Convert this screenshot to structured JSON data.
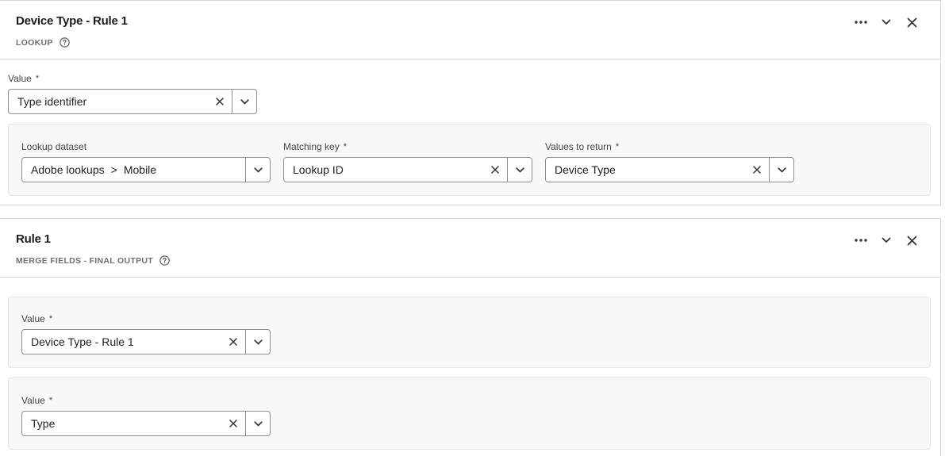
{
  "card1": {
    "title": "Device Type - Rule 1",
    "subtitle": "LOOKUP",
    "value_label": "Value",
    "value_text": "Type identifier",
    "lookup_dataset_label": "Lookup dataset",
    "lookup_dataset_parts": [
      "Adobe lookups",
      ">",
      "Mobile"
    ],
    "matching_key_label": "Matching key",
    "matching_key_value": "Lookup ID",
    "values_return_label": "Values to return",
    "values_return_value": "Device Type"
  },
  "card2": {
    "title": "Rule 1",
    "subtitle": "MERGE FIELDS - FINAL OUTPUT",
    "value1_label": "Value",
    "value1_text": "Device Type - Rule 1",
    "value2_label": "Value",
    "value2_text": "Type"
  },
  "required_marker": "*",
  "icons": {
    "more": "more-icon",
    "collapse": "chevron-down-icon",
    "close": "close-icon",
    "help": "help-icon",
    "clear": "clear-icon",
    "dropdown": "chevron-down-icon"
  }
}
